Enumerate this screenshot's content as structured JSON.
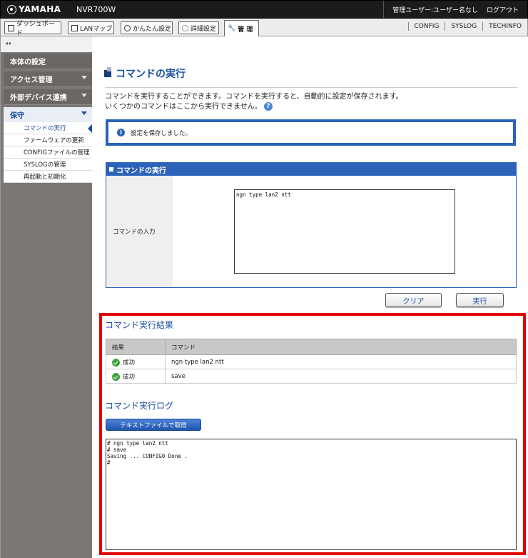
{
  "header": {
    "brand": "YAMAHA",
    "model": "NVR700W",
    "user": "管理ユーザー:ユーザー名なし",
    "logout": "ログアウト"
  },
  "tabs": [
    {
      "label": "ダッシュボード",
      "icon": "dashboard-icon"
    },
    {
      "label": "LANマップ",
      "icon": "lan-map-icon"
    },
    {
      "label": "かんたん設定",
      "icon": "wizard-icon"
    },
    {
      "label": "詳細設定",
      "icon": "gear-icon"
    },
    {
      "label": "管 理",
      "icon": "wrench-icon"
    }
  ],
  "quick_links": [
    "CONFIG",
    "SYSLOG",
    "TECHINFO"
  ],
  "sidebar": {
    "collapse": "◂◂",
    "items": [
      {
        "label": "本体の設定"
      },
      {
        "label": "アクセス管理"
      },
      {
        "label": "外部デバイス連携"
      },
      {
        "label": "保守"
      }
    ],
    "submenu": [
      "コマンドの実行",
      "ファームウェアの更新",
      "CONFIGファイルの管理",
      "SYSLOGの管理",
      "再起動と初期化"
    ]
  },
  "main": {
    "title": "コマンドの実行",
    "desc_line1": "コマンドを実行することができます。コマンドを実行すると、自動的に設定が保存されます。",
    "desc_line2": "いくつかのコマンドはここから実行できません。",
    "help": "?",
    "notice_icon": "i",
    "notice": "設定を保存しました。",
    "panel_title": "コマンドの実行",
    "input_label": "コマンドの入力",
    "input_value": "ngn type lan2 ntt",
    "clear_button": "クリア",
    "execute_button": "実行",
    "result_title": "コマンド実行結果",
    "result_headers": {
      "result": "結果",
      "command": "コマンド"
    },
    "results": [
      {
        "status": "成功",
        "command": "ngn type lan2 ntt"
      },
      {
        "status": "成功",
        "command": "save"
      }
    ],
    "log_title": "コマンド実行ログ",
    "download_button": "テキストファイルで取得",
    "log_text": "# ngn type lan2 ntt\n# save\nSaving ... CONFIG0 Done .\n#"
  }
}
